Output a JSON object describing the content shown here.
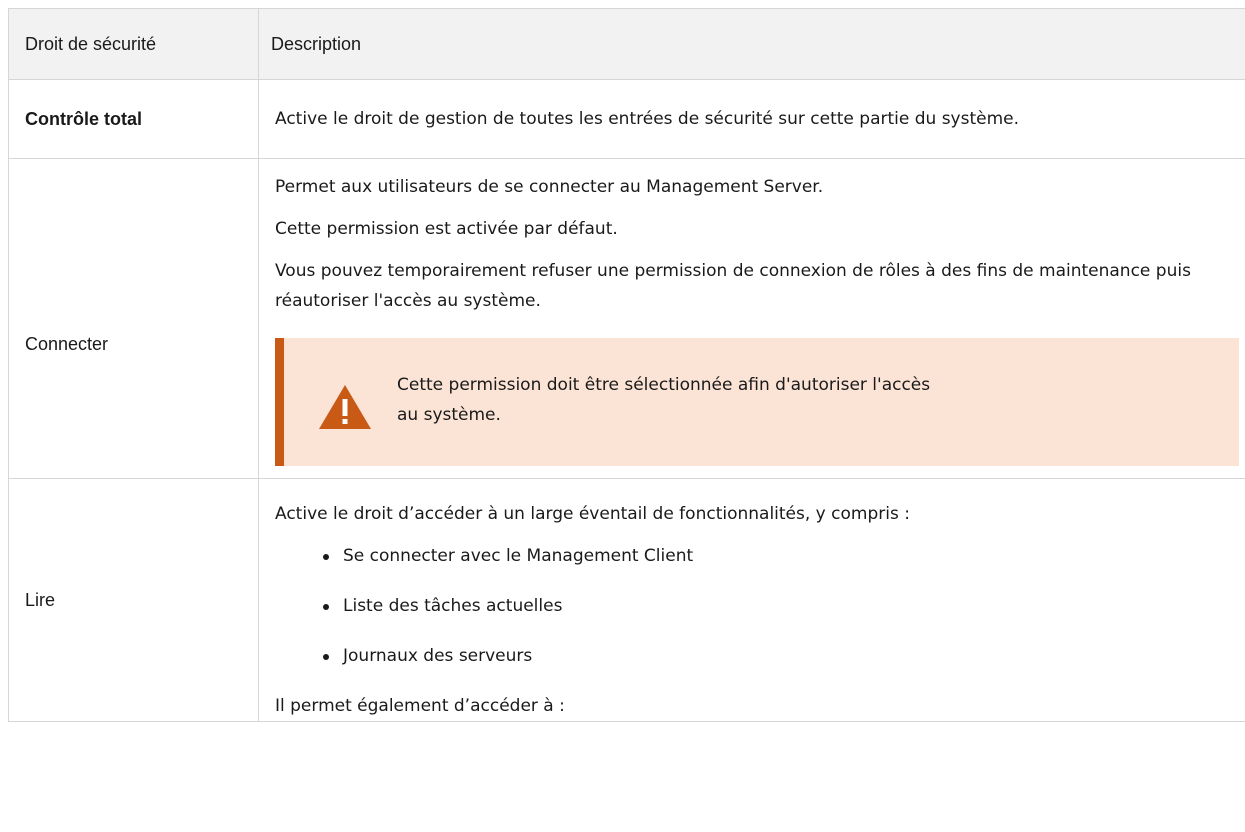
{
  "table": {
    "headers": [
      "Droit de sécurité",
      "Description"
    ],
    "rows": [
      {
        "right": "Contrôle total",
        "description": "Active le droit de gestion de toutes les entrées de sécurité sur cette partie du système."
      },
      {
        "right": "Connecter",
        "paragraphs": [
          "Permet aux utilisateurs de se connecter au Management Server.",
          "Cette permission est activée par défaut.",
          "Vous pouvez temporairement refuser une permission de connexion de rôles à des fins de maintenance puis réautoriser l'accès au système."
        ],
        "warning": {
          "icon": "warning-triangle-icon",
          "text_line1": "Cette permission doit être sélectionnée afin d'autoriser l'accès",
          "text_line2": "au système.",
          "accent_color": "#c85a16",
          "background_color": "#fbe3d6"
        }
      },
      {
        "right": "Lire",
        "intro": "Active le droit d’accéder à un large éventail de fonctionnalités, y compris :",
        "items": [
          "Se connecter avec le Management Client",
          "Liste des tâches actuelles",
          "Journaux des serveurs"
        ],
        "outro": "Il permet également d’accéder à :"
      }
    ]
  }
}
